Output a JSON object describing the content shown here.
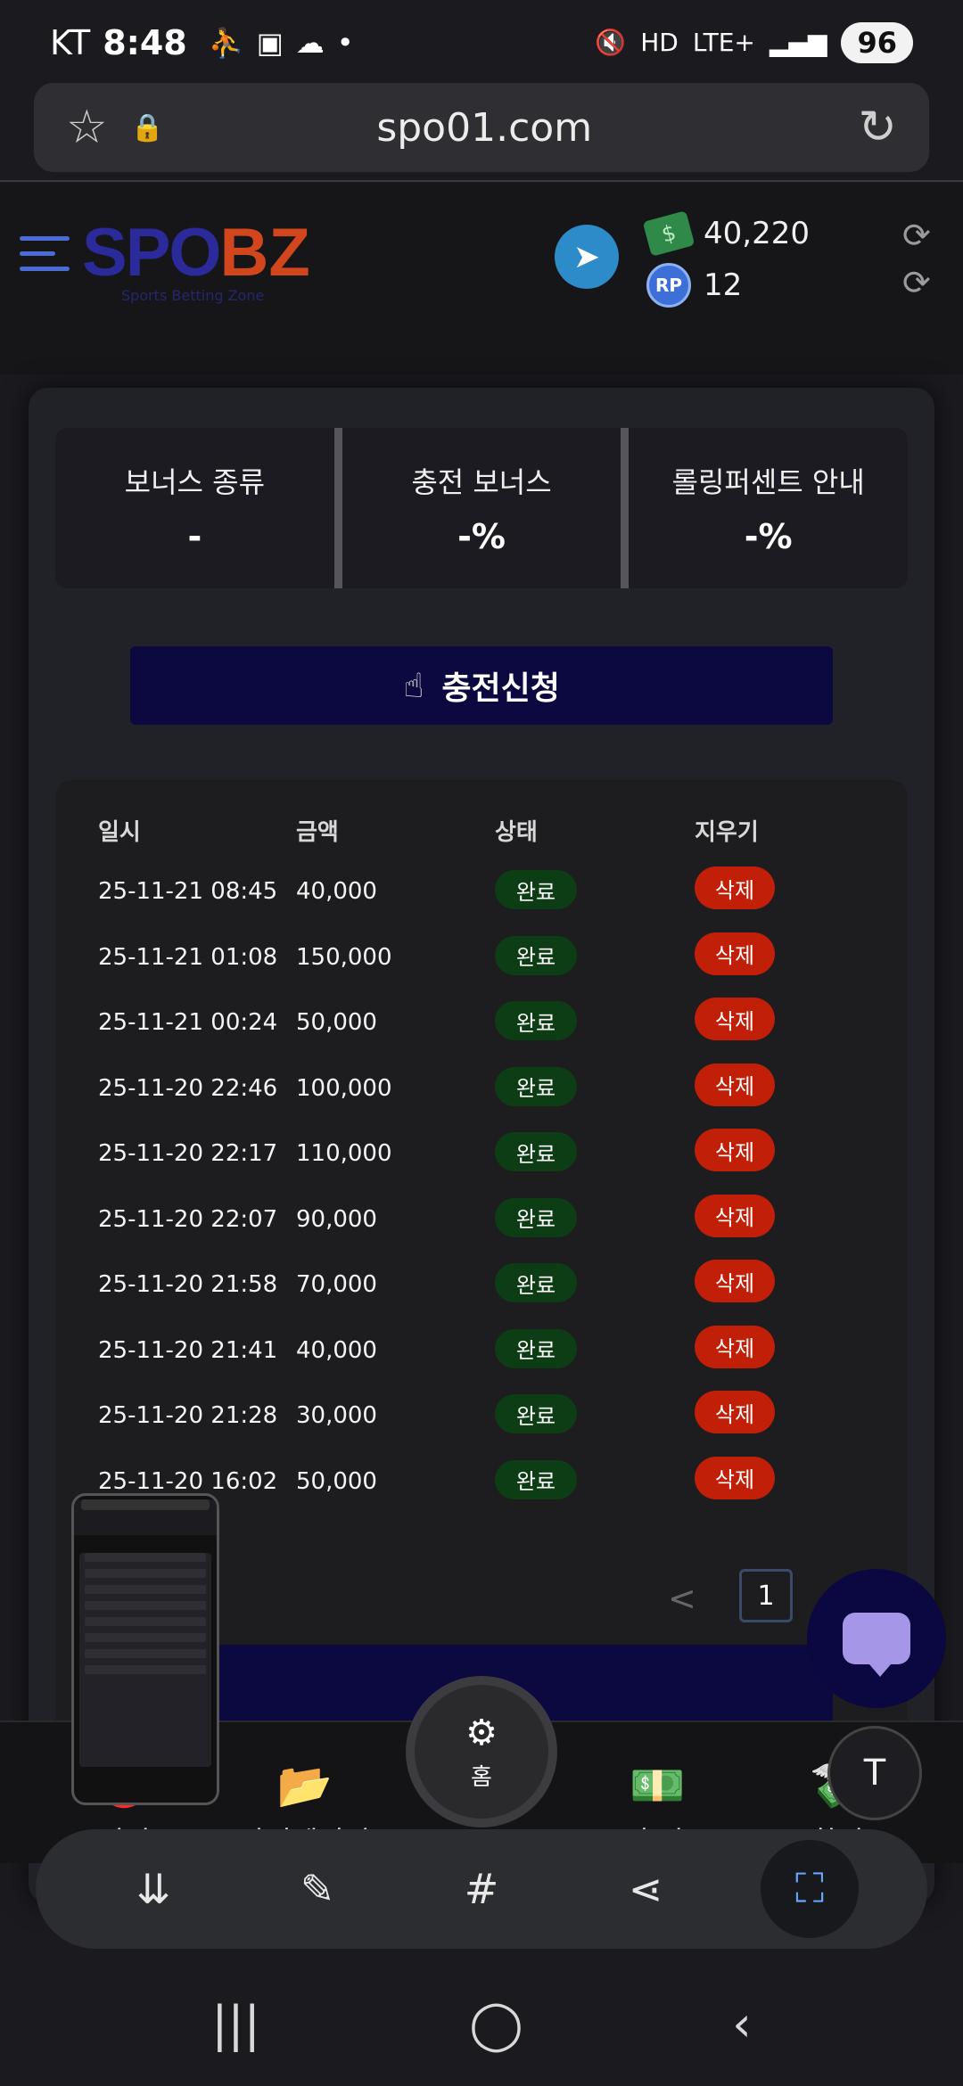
{
  "status_bar": {
    "carrier": "KT",
    "time": "8:48",
    "battery": "96",
    "network": "LTE+",
    "hd": "HD"
  },
  "browser": {
    "url": "spo01.com"
  },
  "header": {
    "logo_spo": "SPO",
    "logo_bz": "BZ",
    "logo_sub": "Sports Betting Zone",
    "money": "40,220",
    "points": "12",
    "rp_label": "RP"
  },
  "bonus_info": {
    "type_label": "보너스 종류",
    "type_value": "-",
    "charge_label": "충전 보너스",
    "charge_value": "-%",
    "rolling_label": "롤링퍼센트 안내",
    "rolling_value": "-%"
  },
  "apply_button": "충전신청",
  "table": {
    "headers": [
      "일시",
      "금액",
      "상태",
      "지우기"
    ],
    "rows": [
      {
        "date": "25-11-21 08:45",
        "amount": "40,000",
        "status": "완료",
        "action": "삭제"
      },
      {
        "date": "25-11-21 01:08",
        "amount": "150,000",
        "status": "완료",
        "action": "삭제"
      },
      {
        "date": "25-11-21 00:24",
        "amount": "50,000",
        "status": "완료",
        "action": "삭제"
      },
      {
        "date": "25-11-20 22:46",
        "amount": "100,000",
        "status": "완료",
        "action": "삭제"
      },
      {
        "date": "25-11-20 22:17",
        "amount": "110,000",
        "status": "완료",
        "action": "삭제"
      },
      {
        "date": "25-11-20 22:07",
        "amount": "90,000",
        "status": "완료",
        "action": "삭제"
      },
      {
        "date": "25-11-20 21:58",
        "amount": "70,000",
        "status": "완료",
        "action": "삭제"
      },
      {
        "date": "25-11-20 21:41",
        "amount": "40,000",
        "status": "완료",
        "action": "삭제"
      },
      {
        "date": "25-11-20 21:28",
        "amount": "30,000",
        "status": "완료",
        "action": "삭제"
      },
      {
        "date": "25-11-20 16:02",
        "amount": "50,000",
        "status": "완료",
        "action": "삭제"
      }
    ]
  },
  "pagination": {
    "prev": "<",
    "current": "1"
  },
  "bottom_nav": {
    "mission": "미션",
    "mypage": "마이페이지",
    "home": "홈",
    "charge": "충전",
    "exchange": "환전"
  },
  "colors": {
    "status_done": "#0d3d14",
    "delete": "#c21f08",
    "button_bg": "#0c0840"
  }
}
